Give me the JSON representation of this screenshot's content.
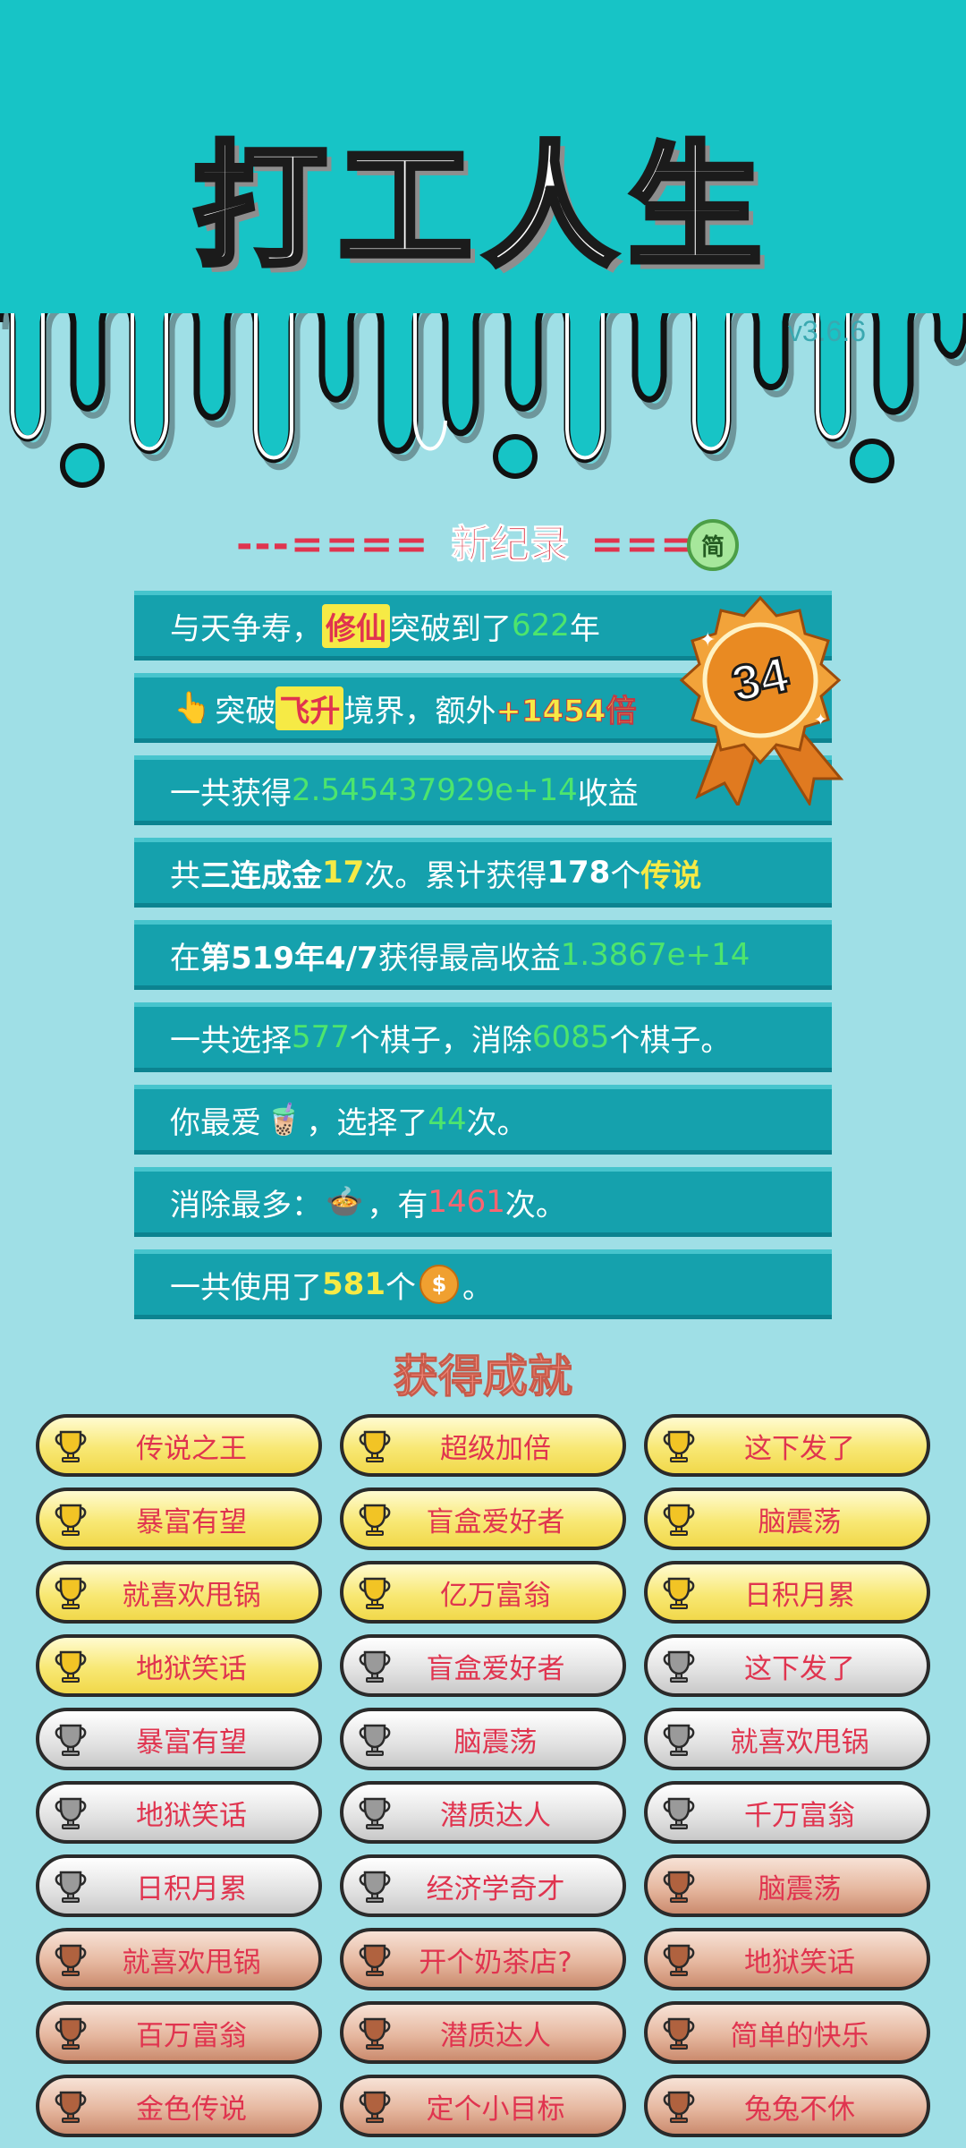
{
  "app": {
    "title": "打工人生",
    "version": "v3.6.6",
    "simp_badge": "简"
  },
  "record": {
    "title": "新纪录",
    "dash_left": "---====",
    "dash_right": "====",
    "medal_number": "34"
  },
  "stats": [
    {
      "parts": [
        {
          "t": "与天争寿，"
        },
        {
          "t": "修仙",
          "c": "hl"
        },
        {
          "t": "突破到了"
        },
        {
          "t": "622",
          "c": "g"
        },
        {
          "t": "年"
        }
      ]
    },
    {
      "parts": [
        {
          "t": "👆",
          "c": "icon"
        },
        {
          "t": "突破"
        },
        {
          "t": "飞升",
          "c": "hl"
        },
        {
          "t": "境界，额外"
        },
        {
          "t": "+1454倍",
          "c": "bonus"
        }
      ]
    },
    {
      "parts": [
        {
          "t": "一共获得"
        },
        {
          "t": "2.545437929e+14",
          "c": "g"
        },
        {
          "t": "收益"
        }
      ]
    },
    {
      "parts": [
        {
          "t": "共"
        },
        {
          "t": "三连成金",
          "c": "w"
        },
        {
          "t": "17",
          "c": "y"
        },
        {
          "t": "次。累计获得"
        },
        {
          "t": "178",
          "c": "w"
        },
        {
          "t": "个"
        },
        {
          "t": "传说",
          "c": "y"
        }
      ]
    },
    {
      "parts": [
        {
          "t": "在 "
        },
        {
          "t": "第519年4/7",
          "c": "w"
        },
        {
          "t": " 获得最高收益"
        },
        {
          "t": "1.3867e+14",
          "c": "g"
        }
      ]
    },
    {
      "parts": [
        {
          "t": "一共选择"
        },
        {
          "t": "577",
          "c": "g"
        },
        {
          "t": "个棋子，消除"
        },
        {
          "t": "6085",
          "c": "g"
        },
        {
          "t": "个棋子。"
        }
      ]
    },
    {
      "parts": [
        {
          "t": "你最爱"
        },
        {
          "t": "🧋",
          "c": "icon"
        },
        {
          "t": "，选择了"
        },
        {
          "t": "44",
          "c": "g"
        },
        {
          "t": "次。"
        }
      ]
    },
    {
      "parts": [
        {
          "t": "消除最多："
        },
        {
          "t": "🍲",
          "c": "icon"
        },
        {
          "t": "，有"
        },
        {
          "t": "1461",
          "c": "r"
        },
        {
          "t": "次。"
        }
      ]
    },
    {
      "parts": [
        {
          "t": "一共使用了"
        },
        {
          "t": "581",
          "c": "y"
        },
        {
          "t": "个"
        },
        {
          "t": "$",
          "c": "coin"
        },
        {
          "t": "。"
        }
      ]
    }
  ],
  "achievements_title": "获得成就",
  "achievements": [
    {
      "label": "传说之王",
      "tier": "gold"
    },
    {
      "label": "超级加倍",
      "tier": "gold"
    },
    {
      "label": "这下发了",
      "tier": "gold"
    },
    {
      "label": "暴富有望",
      "tier": "gold"
    },
    {
      "label": "盲盒爱好者",
      "tier": "gold"
    },
    {
      "label": "脑震荡",
      "tier": "gold"
    },
    {
      "label": "就喜欢甩锅",
      "tier": "gold"
    },
    {
      "label": "亿万富翁",
      "tier": "gold"
    },
    {
      "label": "日积月累",
      "tier": "gold"
    },
    {
      "label": "地狱笑话",
      "tier": "gold"
    },
    {
      "label": "盲盒爱好者",
      "tier": "silver"
    },
    {
      "label": "这下发了",
      "tier": "silver"
    },
    {
      "label": "暴富有望",
      "tier": "silver"
    },
    {
      "label": "脑震荡",
      "tier": "silver"
    },
    {
      "label": "就喜欢甩锅",
      "tier": "silver"
    },
    {
      "label": "地狱笑话",
      "tier": "silver"
    },
    {
      "label": "潜质达人",
      "tier": "silver"
    },
    {
      "label": "千万富翁",
      "tier": "silver"
    },
    {
      "label": "日积月累",
      "tier": "silver"
    },
    {
      "label": "经济学奇才",
      "tier": "silver"
    },
    {
      "label": "脑震荡",
      "tier": "bronze"
    },
    {
      "label": "就喜欢甩锅",
      "tier": "bronze"
    },
    {
      "label": "开个奶茶店?",
      "tier": "bronze"
    },
    {
      "label": "地狱笑话",
      "tier": "bronze"
    },
    {
      "label": "百万富翁",
      "tier": "bronze"
    },
    {
      "label": "潜质达人",
      "tier": "bronze"
    },
    {
      "label": "简单的快乐",
      "tier": "bronze"
    },
    {
      "label": "金色传说",
      "tier": "bronze"
    },
    {
      "label": "定个小目标",
      "tier": "bronze"
    },
    {
      "label": "兔兔不休",
      "tier": "bronze"
    }
  ],
  "colors": {
    "header_bg": "#17c4c6",
    "row_bg": "#15a1ad",
    "gold_trophy": "#f2c425",
    "silver_trophy": "#9a9a9a",
    "bronze_trophy": "#b0623f"
  }
}
